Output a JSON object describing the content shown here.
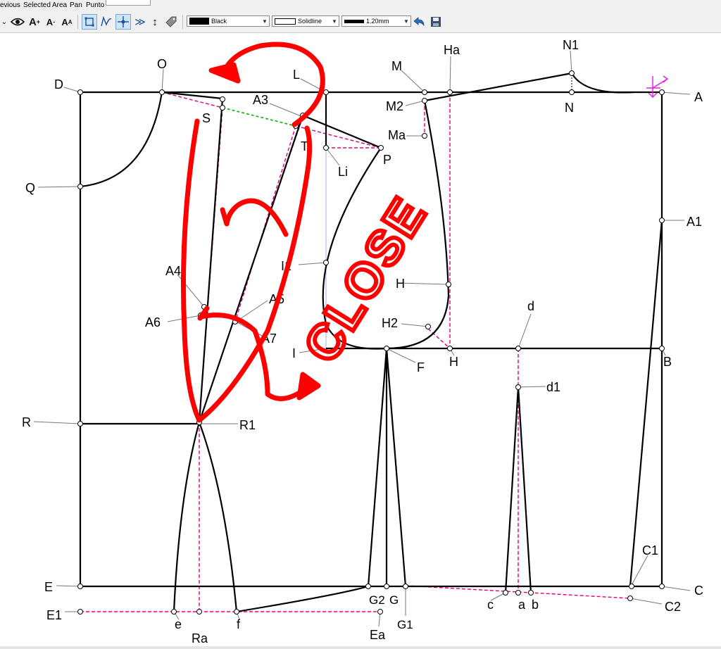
{
  "menu": {
    "items": [
      "evious",
      "Selected",
      "Area",
      "Pan",
      "Punto"
    ]
  },
  "toolbar": {
    "color_combo": {
      "label": "Black",
      "swatch": "#000000"
    },
    "line_style_combo": {
      "label": "Solidline"
    },
    "line_width_combo": {
      "label": "1.20mm"
    },
    "icons": [
      "eye-icon",
      "font-increase-icon",
      "font-decrease-icon",
      "font-style-icon",
      "select-node-icon",
      "curve-icon",
      "crosshair-icon",
      "fast-forward-icon",
      "vertical-arrows-icon",
      "tag-icon",
      "undo-icon",
      "save-icon"
    ]
  },
  "colors": {
    "pattern_line": "#000000",
    "guide_dashed": "#e0007a",
    "guide_green": "#1fb51f",
    "guide_blue": "#9fb6d8",
    "annotation_red": "#ff0000",
    "marker_magenta": "#e020e0"
  },
  "points": {
    "O": "O",
    "L": "L",
    "Ha": "Ha",
    "N1": "N1",
    "M": "M",
    "D": "D",
    "A": "A",
    "N": "N",
    "M2": "M2",
    "A3": "A3",
    "S": "S",
    "Ma": "Ma",
    "T": "T",
    "P": "P",
    "Li": "Li",
    "Q": "Q",
    "A1": "A1",
    "I1": "I1",
    "H1": "H",
    "A4": "A4",
    "A5": "A5",
    "A6": "A6",
    "A7": "A7",
    "d": "d",
    "H2": "H2",
    "I": "I",
    "F": "F",
    "H": "H",
    "B": "B",
    "d1": "d1",
    "R": "R",
    "R1": "R1",
    "C1": "C1",
    "E": "E",
    "G2": "G2",
    "G": "G",
    "C": "C",
    "c": "c",
    "a": "a",
    "b": "b",
    "C2": "C2",
    "E1": "E1",
    "G1": "G1",
    "e": "e",
    "f": "f",
    "Ra": "Ra",
    "Ea": "Ea"
  },
  "annotation": {
    "text": "CLOSE"
  }
}
